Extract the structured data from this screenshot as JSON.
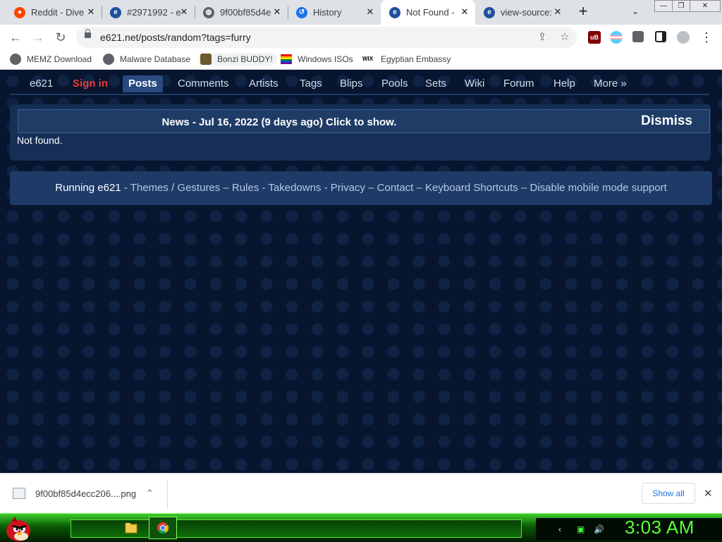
{
  "tabs": [
    {
      "title": "Reddit - Dive",
      "icon": "reddit-icon",
      "color": "#ff4500"
    },
    {
      "title": "#2971992 - e",
      "icon": "e621-icon",
      "color": "#1f4f9e"
    },
    {
      "title": "9f00bf85d4e",
      "icon": "globe-icon",
      "color": "#5f6368"
    },
    {
      "title": "History",
      "icon": "history-icon",
      "color": "#1a73e8"
    },
    {
      "title": "Not Found -",
      "icon": "e621-icon",
      "color": "#1f4f9e"
    },
    {
      "title": "view-source:",
      "icon": "e621-icon",
      "color": "#1f4f9e"
    }
  ],
  "tab_close_glyph": "✕",
  "new_tab_glyph": "+",
  "tab_search_glyph": "⌄",
  "window_controls": [
    "—",
    "❐",
    "✕"
  ],
  "toolbar": {
    "back": "←",
    "forward": "→",
    "reload": "↻",
    "url": "e621.net/posts/random?tags=furry",
    "share_glyph": "⇪",
    "star_glyph": "☆",
    "ublock_label": "uB",
    "menu_glyph": "⋮"
  },
  "bookmarks": [
    {
      "label": "MEMZ Download",
      "icon": "globe-icon"
    },
    {
      "label": "Malware Database",
      "icon": "globe-icon"
    },
    {
      "label": "Bonzi BUDDY!",
      "icon": "bonzi-icon"
    },
    {
      "label": "Windows ISOs",
      "icon": "rainbow-flag-icon"
    },
    {
      "label": "Egyptian Embassy",
      "icon": "wix-icon"
    }
  ],
  "wix_label": "WIX",
  "site_nav": [
    {
      "label": "e621",
      "state": "normal"
    },
    {
      "label": "Sign in",
      "state": "signin"
    },
    {
      "label": "Posts",
      "state": "active"
    },
    {
      "label": "Comments",
      "state": "normal"
    },
    {
      "label": "Artists",
      "state": "normal"
    },
    {
      "label": "Tags",
      "state": "normal"
    },
    {
      "label": "Blips",
      "state": "normal"
    },
    {
      "label": "Pools",
      "state": "normal"
    },
    {
      "label": "Sets",
      "state": "normal"
    },
    {
      "label": "Wiki",
      "state": "normal"
    },
    {
      "label": "Forum",
      "state": "normal"
    },
    {
      "label": "Help",
      "state": "normal"
    },
    {
      "label": "More »",
      "state": "normal"
    }
  ],
  "news": {
    "text": "News - Jul 16, 2022 (9 days ago) Click to show.",
    "dismiss": "Dismiss"
  },
  "message": "Not found.",
  "footer": {
    "running": "Running e621",
    "links": [
      "Themes",
      "Gestures",
      "Rules",
      "Takedowns",
      "Privacy",
      "Contact",
      "Keyboard Shortcuts",
      "Disable mobile mode support"
    ],
    "separators": [
      " - ",
      " / ",
      " – ",
      " - ",
      " - ",
      " – ",
      " – ",
      " – "
    ]
  },
  "downloads": {
    "filename": "9f00bf85d4ecc206....png",
    "chevron": "⌃",
    "show_all": "Show all",
    "close": "✕"
  },
  "taskbar": {
    "clock": "3:03 AM",
    "apps": [
      "folder-icon",
      "chrome-icon"
    ]
  },
  "colors": {
    "page_bg": "#07152e",
    "nav_active": "#284a81",
    "signin": "#e53b3b",
    "taskbar_green": "#3ecc2b",
    "clock_green": "#59ff3a"
  }
}
